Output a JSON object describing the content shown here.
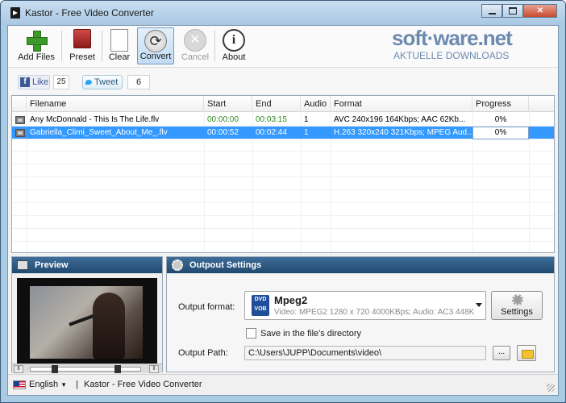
{
  "window": {
    "title": "Kastor - Free Video Converter"
  },
  "toolbar": {
    "add_files": "Add Files",
    "preset": "Preset",
    "clear": "Clear",
    "convert": "Convert",
    "cancel": "Cancel",
    "about": "About"
  },
  "watermark": {
    "main": "soft·ware.net",
    "sub": "AKTUELLE DOWNLOADS"
  },
  "social": {
    "like": "Like",
    "like_count": "25",
    "tweet": "Tweet",
    "tweet_count": "6"
  },
  "list": {
    "columns": [
      "Filename",
      "Start",
      "End",
      "Audio",
      "Format",
      "Progress"
    ],
    "rows": [
      {
        "filename": "Any McDonnald - This Is The Life.flv",
        "start": "00:00:00",
        "end": "00:03:15",
        "audio": "1",
        "format": "AVC 240x196 164Kbps; AAC 62Kb...",
        "progress": "0%"
      },
      {
        "filename": "Gabriella_Climi_Sweet_About_Me_.flv",
        "start": "00:00:52",
        "end": "00:02:44",
        "audio": "1",
        "format": "H.263 320x240 321Kbps; MPEG Aud...",
        "progress": "0%"
      }
    ],
    "selected_row": 1
  },
  "preview": {
    "title": "Preview"
  },
  "output": {
    "title": "Outpout Settings",
    "format_label": "Output format:",
    "format_icon": "DVD VOB",
    "format_name": "Mpeg2",
    "format_desc": "Video: MPEG2 1280 x 720 4000KBps; Audio: AC3 448K",
    "settings_button": "Settings",
    "save_in_dir_label": "Save in the file's directory",
    "save_in_dir_checked": false,
    "path_label": "Output Path:",
    "path_value": "C:\\Users\\JUPP\\Documents\\video\\",
    "browse_button": "..."
  },
  "status": {
    "language": "English",
    "separator": "|",
    "app_name": "Kastor - Free Video Converter"
  }
}
